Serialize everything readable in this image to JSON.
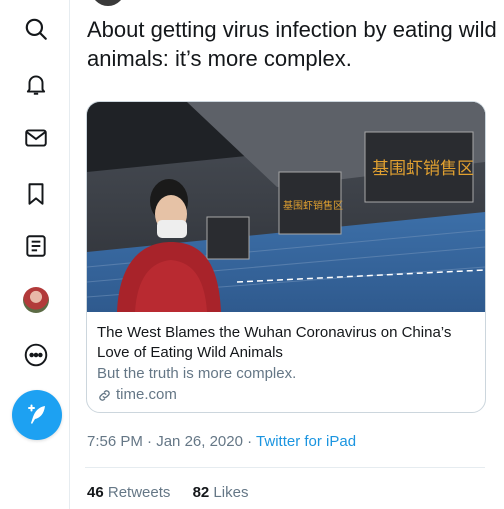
{
  "sidebar": {
    "items": [
      {
        "icon": "search-icon"
      },
      {
        "icon": "bell-icon"
      },
      {
        "icon": "mail-icon"
      },
      {
        "icon": "bookmark-icon"
      },
      {
        "icon": "list-icon"
      },
      {
        "icon": "avatar"
      },
      {
        "icon": "more-icon"
      }
    ],
    "compose_icon": "feather-plus-icon"
  },
  "tweet": {
    "text": "About getting virus infection by eating wild animals: it’s more complex.",
    "card": {
      "sign_left": "基围虾销售区",
      "sign_right": "基围虾销售区",
      "title": "The West Blames the Wuhan Coronavirus on China’s Love of Eating Wild Animals",
      "description": "But the truth is more complex.",
      "domain": "time.com"
    },
    "time": "7:56 PM",
    "separator": "·",
    "date": "Jan 26, 2020",
    "source": "Twitter for iPad",
    "retweets": {
      "count": "46",
      "label": "Retweets"
    },
    "likes": {
      "count": "82",
      "label": "Likes"
    }
  },
  "colors": {
    "accent": "#1da1f2",
    "link": "#1b95e0",
    "muted": "#657786",
    "text": "#14171a"
  }
}
